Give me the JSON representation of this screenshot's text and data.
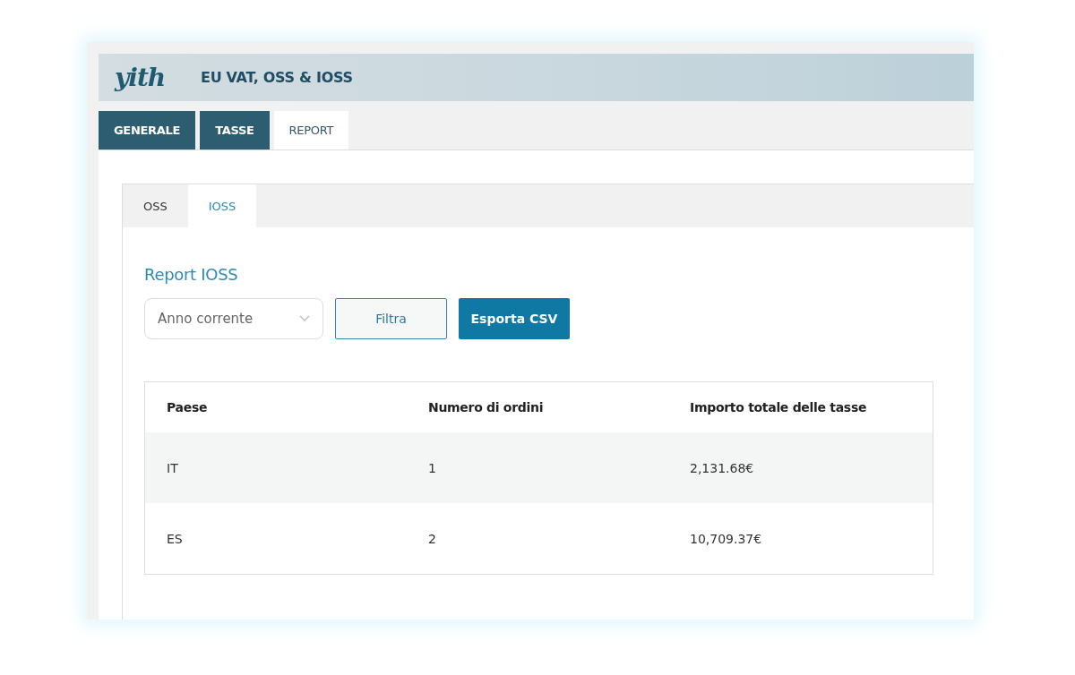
{
  "header": {
    "logo": "yith",
    "title": "EU VAT, OSS & IOSS"
  },
  "tabs": [
    {
      "label": "GENERALE",
      "selected": false
    },
    {
      "label": "TASSE",
      "selected": false
    },
    {
      "label": "REPORT",
      "selected": true
    }
  ],
  "subtabs": [
    {
      "label": "OSS",
      "selected": false
    },
    {
      "label": "IOSS",
      "selected": true
    }
  ],
  "report": {
    "heading": "Report IOSS",
    "period": {
      "value": "Anno corrente"
    },
    "buttons": [
      {
        "label": "Filtra",
        "kind": "secondary"
      },
      {
        "label": "Esporta CSV",
        "kind": "primary"
      }
    ]
  },
  "table": {
    "columns": [
      "Paese",
      "Numero di ordini",
      "Importo totale delle tasse"
    ],
    "rows": [
      [
        "IT",
        "1",
        "2,131.68€"
      ],
      [
        "ES",
        "2",
        "10,709.37€"
      ]
    ]
  }
}
